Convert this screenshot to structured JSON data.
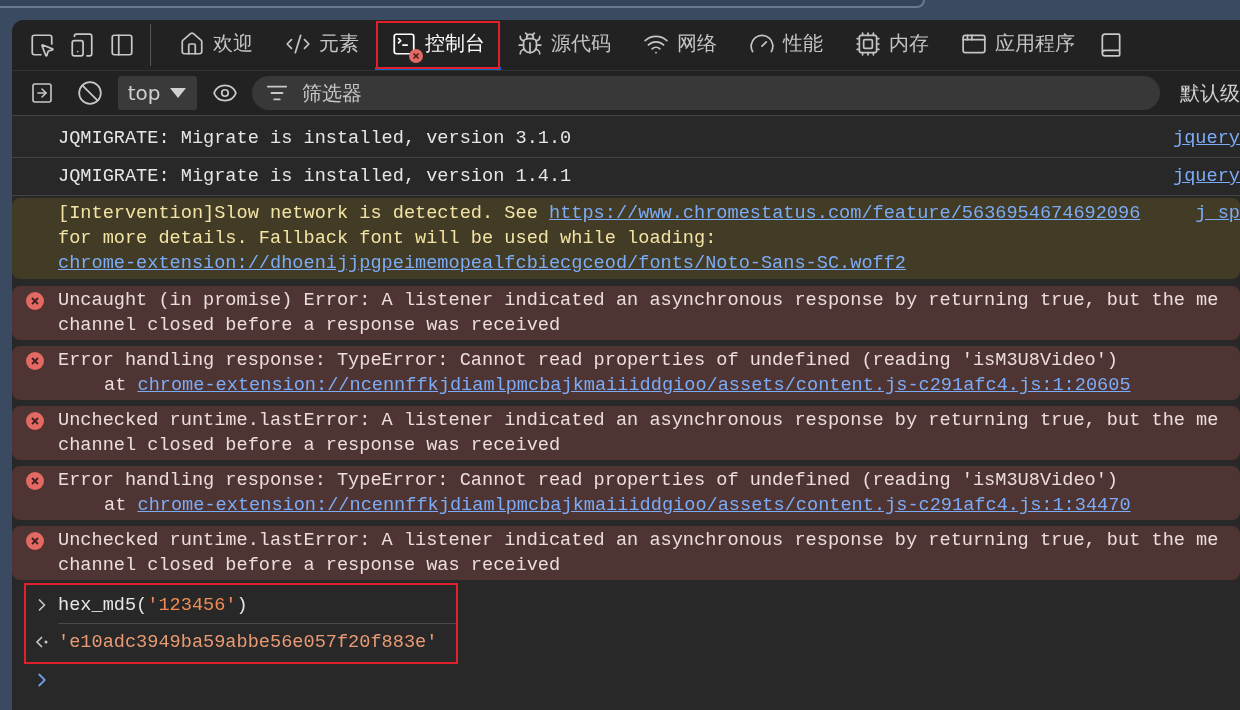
{
  "tabs": [
    {
      "label": "欢迎",
      "kind": "welcome",
      "selected": false,
      "has_errors": false,
      "annotated": false
    },
    {
      "label": "元素",
      "kind": "elements",
      "selected": false,
      "has_errors": false,
      "annotated": false
    },
    {
      "label": "控制台",
      "kind": "console",
      "selected": true,
      "has_errors": true,
      "annotated": true
    },
    {
      "label": "源代码",
      "kind": "sources",
      "selected": false,
      "has_errors": false,
      "annotated": false
    },
    {
      "label": "网络",
      "kind": "network",
      "selected": false,
      "has_errors": false,
      "annotated": false
    },
    {
      "label": "性能",
      "kind": "performance",
      "selected": false,
      "has_errors": false,
      "annotated": false
    },
    {
      "label": "内存",
      "kind": "memory",
      "selected": false,
      "has_errors": false,
      "annotated": false
    },
    {
      "label": "应用程序",
      "kind": "application",
      "selected": false,
      "has_errors": false,
      "annotated": false
    }
  ],
  "filter_bar": {
    "context": "top",
    "placeholder": "筛选器",
    "levels": "默认级"
  },
  "messages": [
    {
      "kind": "log",
      "source": "jquery",
      "lines": [
        {
          "kind": "text",
          "segments": [
            {
              "text": "JQMIGRATE: Migrate is installed, version 3.1.0",
              "kind": "text"
            }
          ]
        }
      ]
    },
    {
      "kind": "log",
      "source": "jquery",
      "lines": [
        {
          "kind": "text",
          "segments": [
            {
              "text": "JQMIGRATE: Migrate is installed, version 1.4.1",
              "kind": "text"
            }
          ]
        }
      ]
    },
    {
      "kind": "warning",
      "source": "j_sp",
      "lines": [
        {
          "kind": "text",
          "segments": [
            {
              "text": "[Intervention]Slow network is detected. See ",
              "kind": "text"
            },
            {
              "text": "https://www.chromestatus.com/feature/5636954674692096",
              "kind": "link"
            }
          ]
        },
        {
          "kind": "text",
          "segments": [
            {
              "text": "for more details. Fallback font will be used while loading:",
              "kind": "text"
            }
          ]
        },
        {
          "kind": "text",
          "segments": [
            {
              "text": "chrome-extension://dhoenijjpgpeimemopealfcbiecgceod/fonts/Noto-Sans-SC.woff2",
              "kind": "link"
            }
          ]
        }
      ]
    },
    {
      "kind": "error",
      "lines": [
        {
          "kind": "text",
          "segments": [
            {
              "text": "Uncaught (in promise) Error: A listener indicated an asynchronous response by returning true, but the me",
              "kind": "text"
            }
          ]
        },
        {
          "kind": "text",
          "segments": [
            {
              "text": "channel closed before a response was received",
              "kind": "text"
            }
          ]
        }
      ]
    },
    {
      "kind": "error",
      "lines": [
        {
          "kind": "text",
          "segments": [
            {
              "text": "Error handling response: TypeError: Cannot read properties of undefined (reading 'isM3U8Video')",
              "kind": "text"
            }
          ]
        },
        {
          "kind": "stack",
          "segments": [
            {
              "text": "at ",
              "kind": "text"
            },
            {
              "text": "chrome-extension://ncennffkjdiamlpmcbajkmaiiiddgioo/assets/content.js-c291afc4.js:1:20605",
              "kind": "link"
            }
          ]
        }
      ]
    },
    {
      "kind": "error",
      "lines": [
        {
          "kind": "text",
          "segments": [
            {
              "text": "Unchecked runtime.lastError: A listener indicated an asynchronous response by returning true, but the me",
              "kind": "text"
            }
          ]
        },
        {
          "kind": "text",
          "segments": [
            {
              "text": "channel closed before a response was received",
              "kind": "text"
            }
          ]
        }
      ]
    },
    {
      "kind": "error",
      "lines": [
        {
          "kind": "text",
          "segments": [
            {
              "text": "Error handling response: TypeError: Cannot read properties of undefined (reading 'isM3U8Video')",
              "kind": "text"
            }
          ]
        },
        {
          "kind": "stack",
          "segments": [
            {
              "text": "at ",
              "kind": "text"
            },
            {
              "text": "chrome-extension://ncennffkjdiamlpmcbajkmaiiiddgioo/assets/content.js-c291afc4.js:1:34470",
              "kind": "link"
            }
          ]
        }
      ]
    },
    {
      "kind": "error",
      "lines": [
        {
          "kind": "text",
          "segments": [
            {
              "text": "Unchecked runtime.lastError: A listener indicated an asynchronous response by returning true, but the me",
              "kind": "text"
            }
          ]
        },
        {
          "kind": "text",
          "segments": [
            {
              "text": "channel closed before a response was received",
              "kind": "text"
            }
          ]
        }
      ]
    }
  ],
  "evaluation": {
    "annotated": true,
    "input": [
      {
        "text": "hex_md5(",
        "kind": "code"
      },
      {
        "text": "'123456'",
        "kind": "string"
      },
      {
        "text": ")",
        "kind": "code"
      }
    ],
    "output": "'e10adc3949ba59abbe56e057f20f883e'"
  }
}
